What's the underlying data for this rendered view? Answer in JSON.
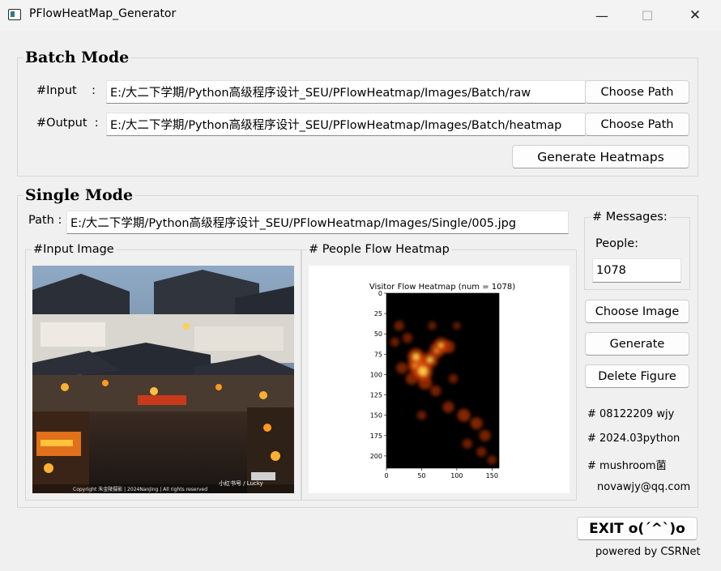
{
  "window": {
    "title": "PFlowHeatMap_Generator",
    "minimize_glyph": "—",
    "maximize_glyph": "☐",
    "close_glyph": "✕"
  },
  "batch": {
    "title": "Batch Mode",
    "input_label": "#Input    :",
    "input_value": "E:/大二下学期/Python高级程序设计_SEU/PFlowHeatmap/Images/Batch/raw",
    "output_label": "#Output  :",
    "output_value": "E:/大二下学期/Python高级程序设计_SEU/PFlowHeatmap/Images/Batch/heatmap",
    "choose_path_label": "Choose Path",
    "generate_label": "Generate Heatmaps"
  },
  "single": {
    "title": "Single Mode",
    "path_label": "Path :",
    "path_value": "E:/大二下学期/Python高级程序设计_SEU/PFlowHeatmap/Images/Single/005.jpg",
    "input_image_title": "#Input Image",
    "heatmap_title": "# People Flow Heatmap",
    "photo_caption": "Copyright 朱金陵摄影 | 2024NanJing | All rights reserved",
    "photo_watermark": "小红书号 / Lucky"
  },
  "messages": {
    "title": "# Messages:",
    "people_label": "People:",
    "people_value": "1078"
  },
  "actions": {
    "choose_image": "Choose Image",
    "generate": "Generate",
    "delete_figure": "Delete Figure"
  },
  "credits": {
    "line1": "# 08122209 wjy",
    "line2": "# 2024.03python",
    "line3": "# mushroom菌",
    "line4": "novawjy@qq.com"
  },
  "exit_label": "EXIT o(´^`)o",
  "powered_by": "powered by CSRNet",
  "colors": {
    "window_bg": "#f0f0f0",
    "heat_background": "#000000",
    "heat_hot": "#ffd84a",
    "heat_mid": "#d23a05"
  },
  "chart_data": {
    "type": "heatmap",
    "title": "Visitor Flow Heatmap (num = 1078)",
    "xlim": [
      0,
      160
    ],
    "ylim": [
      215,
      0
    ],
    "x_ticks": [
      0,
      50,
      100,
      150
    ],
    "y_ticks": [
      0,
      25,
      50,
      75,
      100,
      125,
      150,
      175,
      200
    ],
    "colormap": "hot",
    "hotspots": [
      {
        "x": 45,
        "y": 88,
        "intensity": 1.0
      },
      {
        "x": 52,
        "y": 96,
        "intensity": 0.95
      },
      {
        "x": 42,
        "y": 78,
        "intensity": 0.8
      },
      {
        "x": 62,
        "y": 82,
        "intensity": 0.75
      },
      {
        "x": 72,
        "y": 70,
        "intensity": 0.7
      },
      {
        "x": 78,
        "y": 64,
        "intensity": 0.7
      },
      {
        "x": 88,
        "y": 66,
        "intensity": 0.55
      },
      {
        "x": 55,
        "y": 110,
        "intensity": 0.6
      },
      {
        "x": 36,
        "y": 105,
        "intensity": 0.5
      },
      {
        "x": 22,
        "y": 92,
        "intensity": 0.45
      },
      {
        "x": 18,
        "y": 40,
        "intensity": 0.35
      },
      {
        "x": 12,
        "y": 60,
        "intensity": 0.3
      },
      {
        "x": 30,
        "y": 55,
        "intensity": 0.35
      },
      {
        "x": 70,
        "y": 120,
        "intensity": 0.4
      },
      {
        "x": 88,
        "y": 140,
        "intensity": 0.45
      },
      {
        "x": 110,
        "y": 150,
        "intensity": 0.55
      },
      {
        "x": 128,
        "y": 160,
        "intensity": 0.5
      },
      {
        "x": 140,
        "y": 175,
        "intensity": 0.45
      },
      {
        "x": 135,
        "y": 195,
        "intensity": 0.35
      },
      {
        "x": 115,
        "y": 185,
        "intensity": 0.35
      },
      {
        "x": 50,
        "y": 150,
        "intensity": 0.3
      },
      {
        "x": 95,
        "y": 105,
        "intensity": 0.3
      },
      {
        "x": 100,
        "y": 40,
        "intensity": 0.2
      },
      {
        "x": 65,
        "y": 40,
        "intensity": 0.25
      },
      {
        "x": 150,
        "y": 205,
        "intensity": 0.3
      }
    ]
  }
}
